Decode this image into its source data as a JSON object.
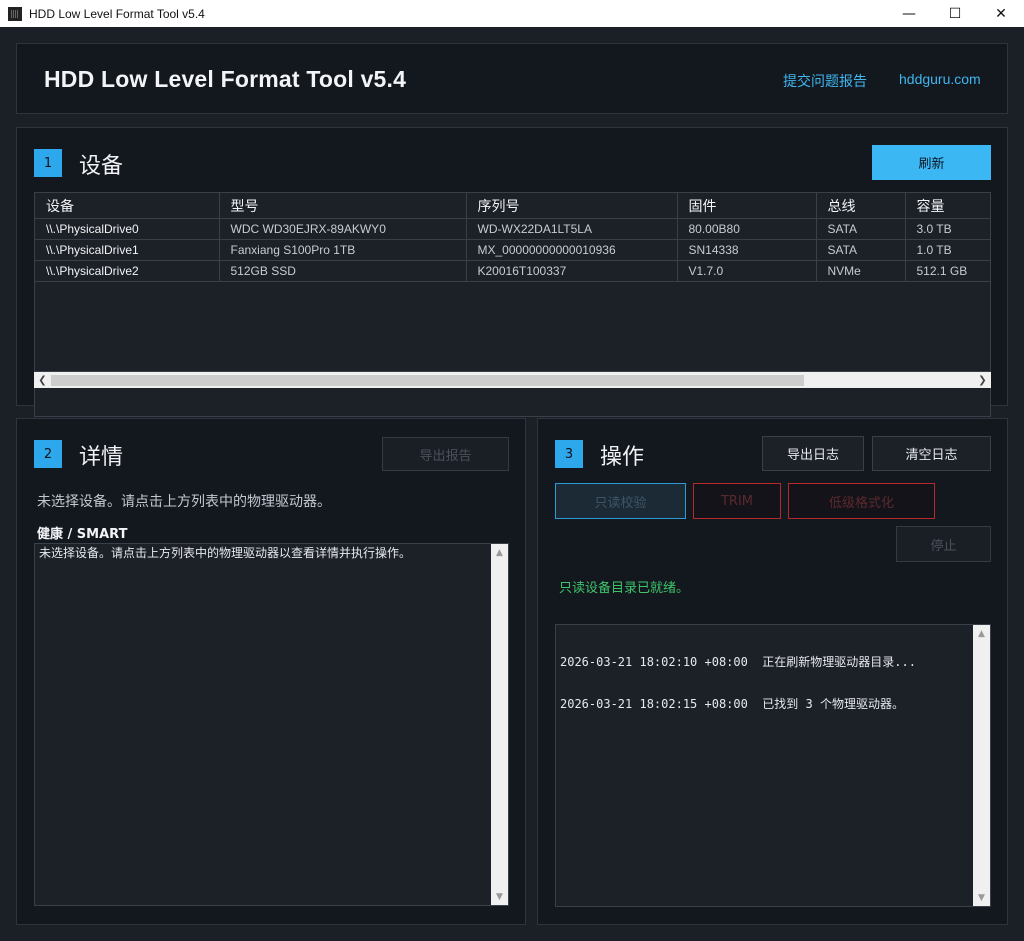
{
  "window": {
    "title": "HDD Low Level Format Tool v5.4",
    "minimize": "—",
    "maximize": "☐",
    "close": "✕"
  },
  "header": {
    "title": "HDD Low Level Format Tool v5.4",
    "report_link": "提交问题报告",
    "site_link": "hddguru.com"
  },
  "devices": {
    "number": "1",
    "title": "设备",
    "refresh_label": "刷新",
    "columns": [
      "设备",
      "型号",
      "序列号",
      "固件",
      "总线",
      "容量"
    ],
    "rows": [
      [
        "\\\\.\\PhysicalDrive0",
        "WDC WD30EJRX-89AKWY0",
        "WD-WX22DA1LT5LA",
        "80.00B80",
        "SATA",
        "3.0 TB"
      ],
      [
        "\\\\.\\PhysicalDrive1",
        "Fanxiang S100Pro 1TB",
        "MX_00000000000010936",
        "SN14338",
        "SATA",
        "1.0 TB"
      ],
      [
        "\\\\.\\PhysicalDrive2",
        "512GB SSD",
        "K20016T100337",
        "V1.7.0",
        "NVMe",
        "512.1 GB"
      ]
    ]
  },
  "details": {
    "number": "2",
    "title": "详情",
    "export_label": "导出报告",
    "no_selection": "未选择设备。请点击上方列表中的物理驱动器。",
    "health_label": "健康 / SMART",
    "health_text": "未选择设备。请点击上方列表中的物理驱动器以查看详情并执行操作。"
  },
  "operations": {
    "number": "3",
    "title": "操作",
    "export_log_label": "导出日志",
    "clear_log_label": "清空日志",
    "verify_label": "只读校验",
    "trim_label": "TRIM",
    "format_label": "低级格式化",
    "stop_label": "停止",
    "status": "只读设备目录已就绪。",
    "log": [
      "2026-03-21 18:02:10 +08:00  正在刷新物理驱动器目录...",
      "2026-03-21 18:02:15 +08:00  已找到 3 个物理驱动器。"
    ]
  }
}
